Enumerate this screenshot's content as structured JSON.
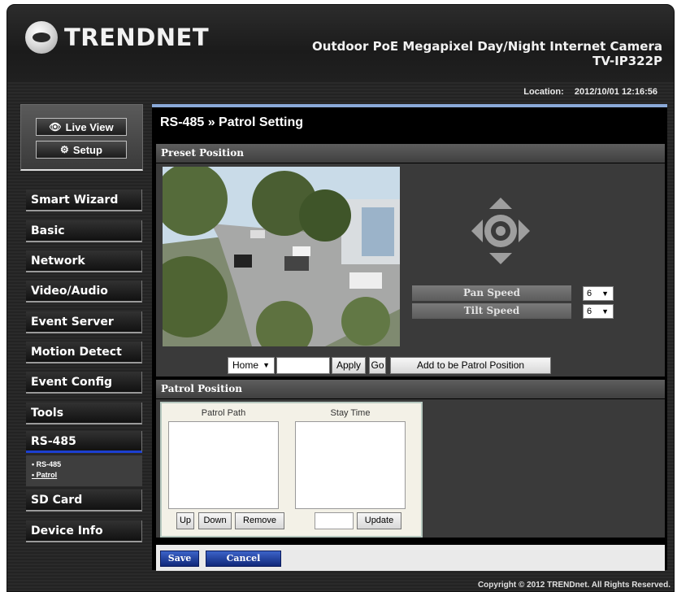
{
  "header": {
    "logo": "TRENDNET",
    "title": "Outdoor PoE Megapixel Day/Night Internet Camera",
    "model": "TV-IP322P",
    "location_label": "Location:",
    "datetime": "2012/10/01 12:16:56"
  },
  "view_buttons": {
    "live_view": "Live View",
    "setup": "Setup"
  },
  "sidebar": {
    "items": [
      {
        "label": "Smart Wizard"
      },
      {
        "label": "Basic"
      },
      {
        "label": "Network"
      },
      {
        "label": "Video/Audio"
      },
      {
        "label": "Event Server"
      },
      {
        "label": "Motion Detect"
      },
      {
        "label": "Event Config"
      },
      {
        "label": "Tools"
      },
      {
        "label": "RS-485"
      },
      {
        "label": "SD Card"
      },
      {
        "label": "Device Info"
      }
    ],
    "submenu": [
      "• RS-485",
      "• Patrol"
    ],
    "active": "RS-485"
  },
  "main": {
    "title": "RS-485 » Patrol Setting",
    "preset_section": "Preset Position",
    "pan_speed_label": "Pan Speed",
    "tilt_speed_label": "Tilt Speed",
    "pan_speed_value": "6",
    "tilt_speed_value": "6",
    "preset_select_value": "Home",
    "apply_label": "Apply",
    "go_label": "Go",
    "add_patrol_label": "Add to be Patrol Position",
    "patrol_section": "Patrol Position",
    "patrol_path_header": "Patrol Path",
    "stay_time_header": "Stay Time",
    "up_label": "Up",
    "down_label": "Down",
    "remove_label": "Remove",
    "update_label": "Update",
    "save_label": "Save",
    "cancel_label": "Cancel"
  },
  "footer": {
    "copyright": "Copyright © 2012 TRENDnet. All Rights Reserved."
  },
  "colors": {
    "accent": "#1c3fd1",
    "top_border": "#8aa9d8",
    "button_blue": "#10287a"
  }
}
